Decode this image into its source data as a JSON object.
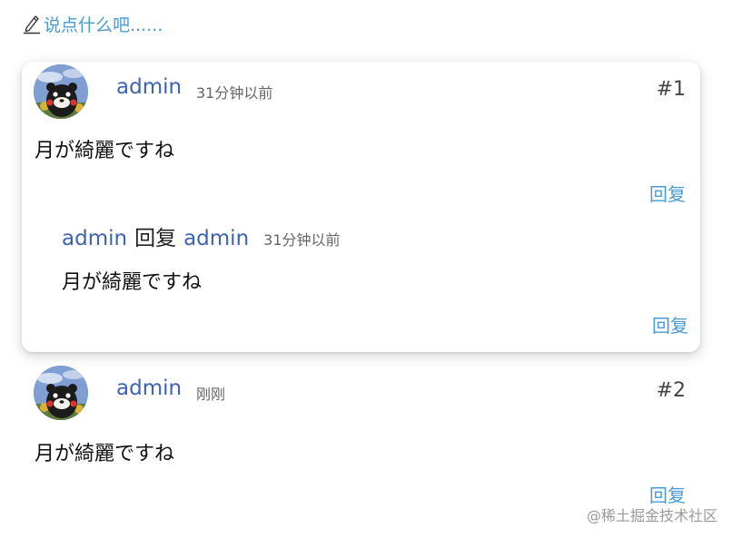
{
  "compose": {
    "icon": "pencil-icon",
    "placeholder": "说点什么吧......"
  },
  "colors": {
    "link": "#3d63b0",
    "action": "#4a9bd6",
    "meta": "#666666"
  },
  "comments": [
    {
      "author": "admin",
      "time": "31分钟以前",
      "floor": "#1",
      "content": "月が綺麗ですね",
      "reply_label": "回复",
      "replies": [
        {
          "author": "admin",
          "verb": "回复",
          "target": "admin",
          "time": "31分钟以前",
          "content": "月が綺麗ですね",
          "reply_label": "回复"
        }
      ]
    },
    {
      "author": "admin",
      "time": "刚刚",
      "floor": "#2",
      "content": "月が綺麗ですね",
      "reply_label": "回复",
      "replies": []
    }
  ],
  "watermark": "@稀土掘金技术社区"
}
